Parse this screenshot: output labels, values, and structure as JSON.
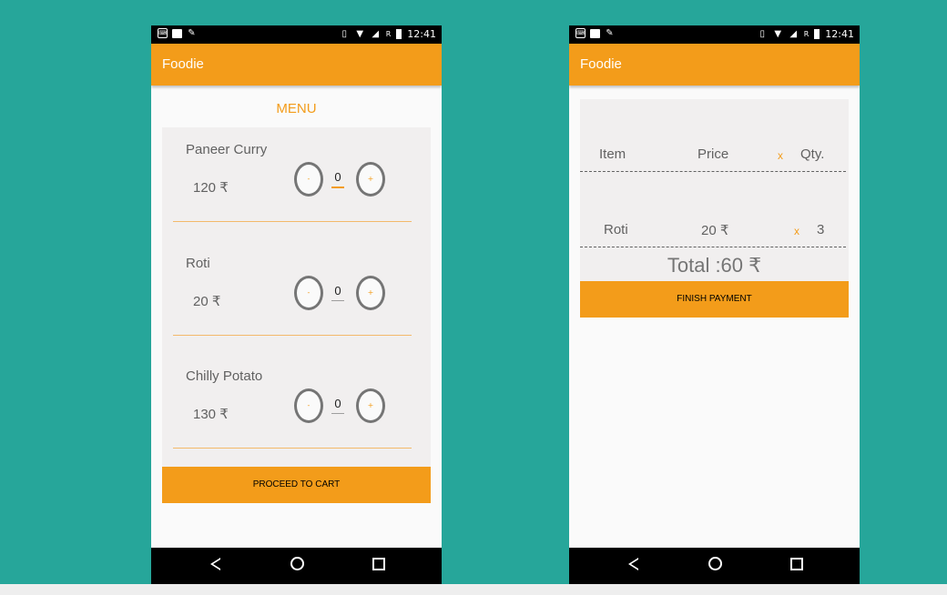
{
  "colors": {
    "background": "#26a69a",
    "accent": "#f39c1a",
    "screen": "#fafafa",
    "card": "#f1efef",
    "bar": "#000000"
  },
  "status_bar": {
    "time": "12:41",
    "icons_left": [
      "keyboard-icon",
      "image-icon",
      "mic-off-icon"
    ],
    "icons_right": [
      "vibrate-icon",
      "wifi-icon",
      "signal-icon",
      "roaming-r",
      "battery-icon"
    ],
    "roaming": "R"
  },
  "app": {
    "title": "Foodie"
  },
  "menu_screen": {
    "heading": "MENU",
    "items": [
      {
        "name": "Paneer Curry",
        "price": "120  ₹",
        "quantity": "0",
        "minus_label": "-",
        "plus_label": "+"
      },
      {
        "name": "Roti",
        "price": "20  ₹",
        "quantity": "0",
        "minus_label": "-",
        "plus_label": "+"
      },
      {
        "name": "Chilly Potato",
        "price": "130  ₹",
        "quantity": "0",
        "minus_label": "-",
        "plus_label": "+"
      }
    ],
    "proceed_label": "PROCEED TO CART"
  },
  "cart_screen": {
    "columns": {
      "item": "Item",
      "price": "Price",
      "times": "x",
      "qty": "Qty."
    },
    "rows": [
      {
        "item": "Roti",
        "price": "20 ₹",
        "times": "x",
        "qty": "3"
      }
    ],
    "total": "Total :60 ₹",
    "finish_label": "FINISH PAYMENT"
  },
  "nav_bar": {
    "buttons": [
      "back-icon",
      "home-icon",
      "recent-apps-icon"
    ]
  }
}
